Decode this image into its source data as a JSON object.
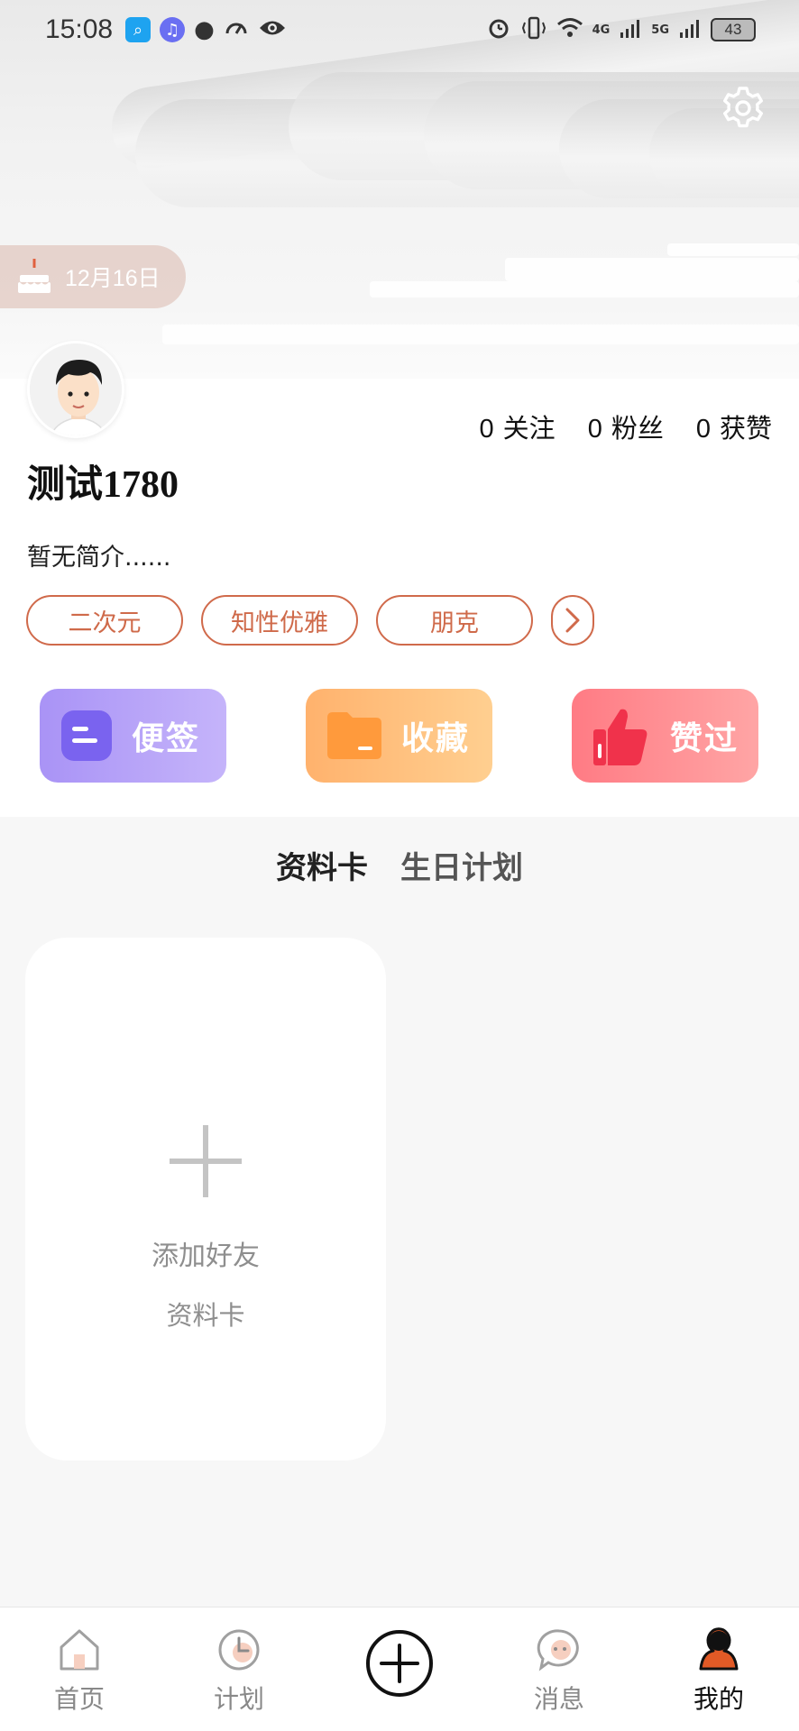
{
  "status_bar": {
    "time": "15:08",
    "battery": "43",
    "network_1": "4G",
    "network_2": "5G",
    "icons": [
      "search-app-icon",
      "music-app-icon",
      "chat-icon",
      "speed-icon",
      "eye-icon",
      "alarm-icon",
      "vibrate-icon",
      "wifi-icon",
      "signal-icon"
    ]
  },
  "header": {
    "birthday": "12月16日",
    "settings_icon": "gear-icon"
  },
  "profile": {
    "nickname": "测试1780",
    "bio": "暂无简介......",
    "stats": [
      {
        "count": "0",
        "label": "关注"
      },
      {
        "count": "0",
        "label": "粉丝"
      },
      {
        "count": "0",
        "label": "获赞"
      }
    ],
    "tags": [
      "二次元",
      "知性优雅",
      "朋克"
    ]
  },
  "quick_actions": [
    {
      "label": "便签",
      "color": "#a993f6"
    },
    {
      "label": "收藏",
      "color": "#ffb26d"
    },
    {
      "label": "赞过",
      "color": "#ff7b84"
    }
  ],
  "tabs": [
    {
      "label": "资料卡",
      "active": true
    },
    {
      "label": "生日计划",
      "active": false
    }
  ],
  "add_card": {
    "line1": "添加好友",
    "line2": "资料卡"
  },
  "bottom_nav": {
    "items": [
      {
        "label": "首页",
        "icon": "home-icon"
      },
      {
        "label": "计划",
        "icon": "clock-icon"
      },
      {
        "label": "",
        "icon": "plus-circle-icon"
      },
      {
        "label": "消息",
        "icon": "message-icon"
      },
      {
        "label": "我的",
        "icon": "user-icon",
        "active": true
      }
    ]
  },
  "colors": {
    "accent": "#d06a4b",
    "background": "#f7f7f7"
  }
}
